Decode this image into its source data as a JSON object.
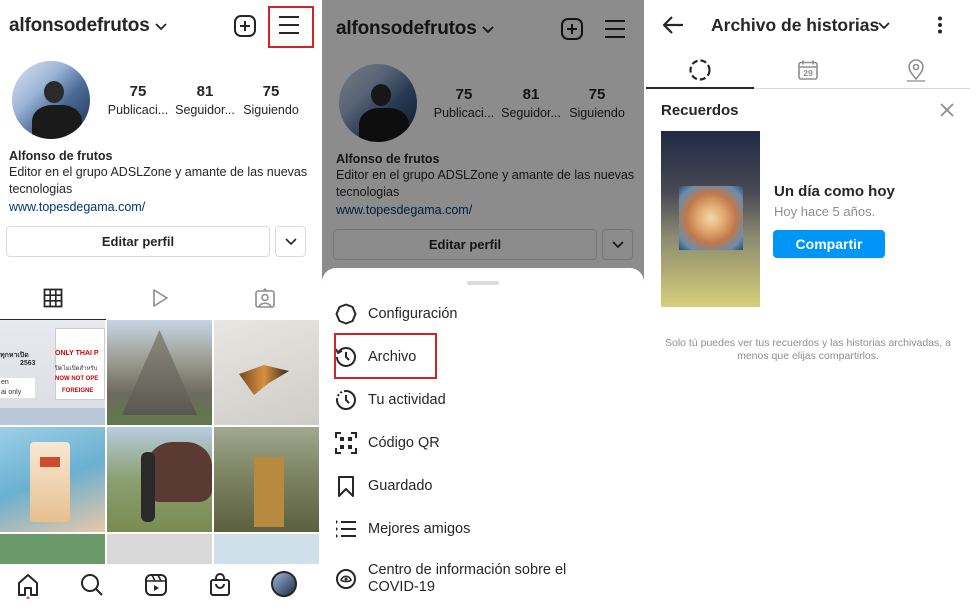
{
  "profile": {
    "username": "alfonsodefrutos",
    "stats": [
      {
        "num": "75",
        "label": "Publicaci..."
      },
      {
        "num": "81",
        "label": "Seguidor..."
      },
      {
        "num": "75",
        "label": "Siguiendo"
      }
    ],
    "name": "Alfonso de frutos",
    "bio_line1": "Editor en el grupo ADSLZone y amante de las nuevas",
    "bio_line2": "tecnologias",
    "link": "www.topesdegama.com/",
    "edit_label": "Editar perfil"
  },
  "grid_photos": [
    {
      "label": "sign",
      "text1": "ทุกหาเปิด",
      "text2": "ONLY THAI P",
      "text3": "ปิดไม่เปิดสำหรับ",
      "text4": "NOW NOT OPE",
      "text5": "FOREIGNE",
      "text6": "2563",
      "text7": "en",
      "text8": "ai only"
    },
    {
      "label": "mountain"
    },
    {
      "label": "butterfly"
    },
    {
      "label": "cup"
    },
    {
      "label": "elephant"
    },
    {
      "label": "temple"
    }
  ],
  "menu": {
    "items": [
      {
        "label": "Configuración",
        "icon": "settings-icon"
      },
      {
        "label": "Archivo",
        "icon": "archive-icon"
      },
      {
        "label": "Tu actividad",
        "icon": "activity-icon"
      },
      {
        "label": "Código QR",
        "icon": "qr-icon"
      },
      {
        "label": "Guardado",
        "icon": "bookmark-icon"
      },
      {
        "label": "Mejores amigos",
        "icon": "close-friends-icon"
      },
      {
        "label": "Centro de información sobre el",
        "label2": "COVID-19",
        "icon": "covid-icon"
      }
    ]
  },
  "archive": {
    "title": "Archivo de historias",
    "calendar_day": "29",
    "memories_title": "Recuerdos",
    "memory_heading": "Un día como hoy",
    "memory_sub": "Hoy hace 5 años.",
    "share_label": "Compartir",
    "note_line1": "Solo tú puedes ver tus recuerdos y las historias archivadas, a",
    "note_line2": "menos que elijas compartirlos."
  },
  "colors": {
    "accent": "#0095f6",
    "highlight_box": "#d2232a",
    "link": "#00376b"
  }
}
